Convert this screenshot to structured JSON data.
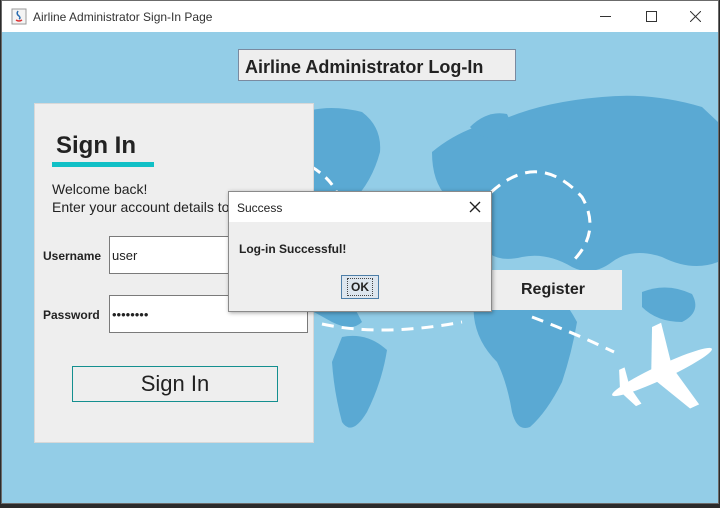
{
  "window": {
    "title": "Airline Administrator Sign-In Page",
    "controls": {
      "minimize": "minimize-icon",
      "maximize": "maximize-icon",
      "close": "close-icon"
    }
  },
  "header": {
    "title": "Airline Administrator Log-In"
  },
  "signin": {
    "heading": "Sign In",
    "welcome_line1": "Welcome back!",
    "welcome_line2": "Enter your account details to c",
    "username_label": "Username",
    "username_value": "user",
    "password_label": "Password",
    "password_value": "••••••••",
    "button_label": "Sign In"
  },
  "register": {
    "label": "Register"
  },
  "dialog": {
    "title": "Success",
    "message": "Log-in Successful!",
    "ok_label": "OK"
  },
  "colors": {
    "background": "#93cde7",
    "land": "#5aa9d3",
    "accent": "#11c0c6",
    "panel": "#eeeeee"
  }
}
